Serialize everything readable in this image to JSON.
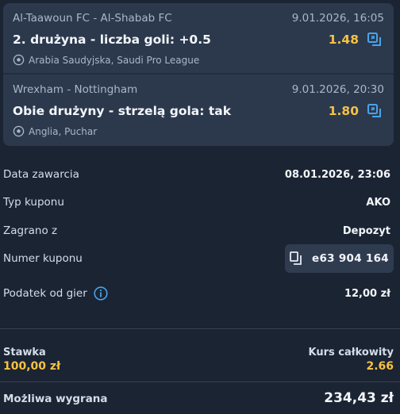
{
  "bets": [
    {
      "teams": "Al-Taawoun FC - Al-Shabab FC",
      "date": "9.01.2026, 16:05",
      "market": "2. drużyna - liczba goli: +0.5",
      "odds": "1.48",
      "league": "Arabia Saudyjska, Saudi Pro League"
    },
    {
      "teams": "Wrexham - Nottingham",
      "date": "9.01.2026, 20:30",
      "market": "Obie drużyny - strzelą gola: tak",
      "odds": "1.80",
      "league": "Anglia, Puchar"
    }
  ],
  "details": {
    "date_label": "Data zawarcia",
    "date_value": "08.01.2026, 23:06",
    "type_label": "Typ kuponu",
    "type_value": "AKO",
    "played_label": "Zagrano z",
    "played_value": "Depozyt",
    "coupon_label": "Numer kuponu",
    "coupon_value": "e63 904 164",
    "tax_label": "Podatek od gier",
    "tax_value": "12,00 zł"
  },
  "summary": {
    "stake_label": "Stawka",
    "stake_value": "100,00 zł",
    "total_label": "Kurs całkowity",
    "total_value": "2.66",
    "win_label": "Możliwa wygrana",
    "win_value": "234,43 zł"
  },
  "colors": {
    "background": "#1b2433",
    "card": "#2c394d",
    "accent": "#f5c242",
    "icon": "#4aa3e8"
  },
  "icons": [
    "copy-icon",
    "soccer-ball-icon",
    "info-icon"
  ]
}
